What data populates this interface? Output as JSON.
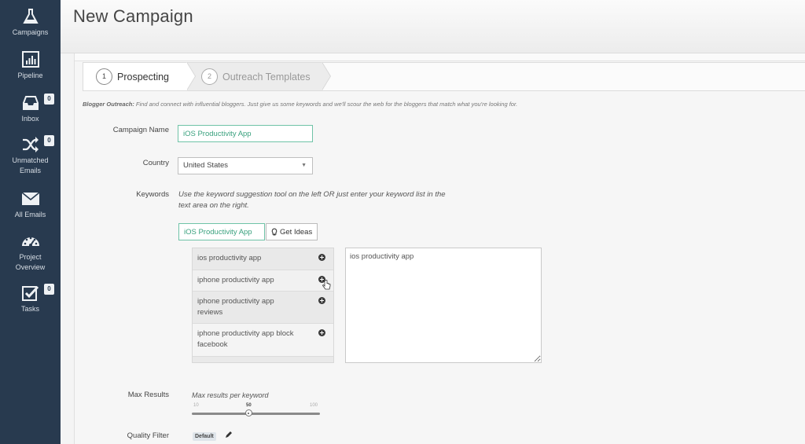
{
  "sidebar": {
    "items": [
      {
        "label": "Campaigns",
        "icon": "flask-icon"
      },
      {
        "label": "Pipeline",
        "icon": "bar-chart-icon"
      },
      {
        "label": "Inbox",
        "icon": "inbox-tray-icon",
        "badge": "0"
      },
      {
        "label": "Unmatched Emails",
        "label_line1": "Unmatched",
        "label_line2": "Emails",
        "icon": "shuffle-icon",
        "badge": "0"
      },
      {
        "label": "All Emails",
        "icon": "envelope-icon"
      },
      {
        "label": "Project Overview",
        "label_line1": "Project",
        "label_line2": "Overview",
        "icon": "dashboard-gauge-icon"
      },
      {
        "label": "Tasks",
        "icon": "checkbox-icon",
        "badge": "0"
      }
    ]
  },
  "header": {
    "title": "New Campaign"
  },
  "wizard": {
    "steps": [
      {
        "number": "1",
        "label": "Prospecting",
        "active": true
      },
      {
        "number": "2",
        "label": "Outreach Templates",
        "active": false
      }
    ]
  },
  "intro": {
    "bold": "Blogger Outreach:",
    "text": " Find and connect with influential bloggers. Just give us some keywords and we'll scour the web for the bloggers that match what you're looking for."
  },
  "form": {
    "campaign_name": {
      "label": "Campaign Name",
      "value": "iOS Productivity App"
    },
    "country": {
      "label": "Country",
      "value": "United States"
    },
    "keywords": {
      "label": "Keywords",
      "hint_line1": "Use the keyword suggestion tool on the left OR just enter your keyword list in the",
      "hint_line2": "text area on the right.",
      "search_value": "iOS Productivity App",
      "get_ideas_label": "Get Ideas",
      "suggestions": [
        {
          "line1": "ios productivity app",
          "line2": ""
        },
        {
          "line1": "iphone productivity app",
          "line2": ""
        },
        {
          "line1": "iphone productivity app",
          "line2": "reviews"
        },
        {
          "line1": "iphone productivity app block",
          "line2": "facebook"
        }
      ],
      "keyword_list": "ios productivity app"
    },
    "max_results": {
      "label": "Max Results",
      "hint": "Max results per keyword",
      "min": "10",
      "max": "100",
      "value": "50",
      "value_fraction": 0.444
    },
    "quality_filter": {
      "label": "Quality Filter",
      "value": "Default"
    }
  },
  "colors": {
    "sidebar_bg": "#283a4f",
    "focus_accent": "#6fc3a7"
  }
}
